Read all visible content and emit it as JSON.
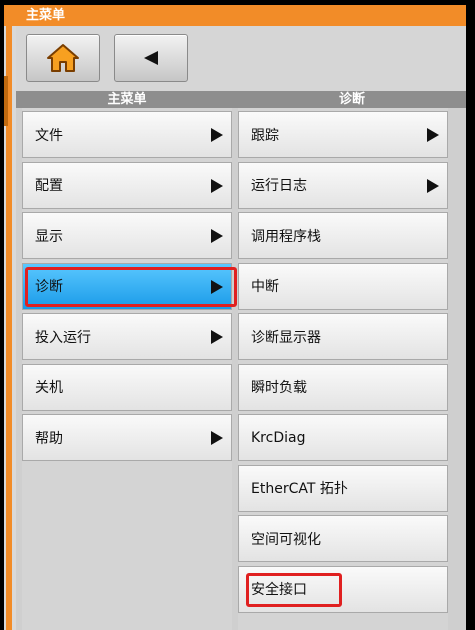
{
  "window": {
    "title": "主菜单"
  },
  "toolbar": {
    "home_icon": "home-icon",
    "back_icon": "back-arrow-icon",
    "accent_color": "#f28c28"
  },
  "main_menu": {
    "header": "主菜单",
    "items": [
      {
        "label": "文件",
        "submenu": true
      },
      {
        "label": "配置",
        "submenu": true
      },
      {
        "label": "显示",
        "submenu": true
      },
      {
        "label": "诊断",
        "submenu": true,
        "selected": true,
        "highlighted": true
      },
      {
        "label": "投入运行",
        "submenu": true
      },
      {
        "label": "关机",
        "submenu": false
      },
      {
        "label": "帮助",
        "submenu": true
      }
    ]
  },
  "diag_menu": {
    "header": "诊断",
    "items": [
      {
        "label": "跟踪",
        "submenu": true
      },
      {
        "label": "运行日志",
        "submenu": true
      },
      {
        "label": "调用程序栈",
        "submenu": false
      },
      {
        "label": "中断",
        "submenu": false
      },
      {
        "label": "诊断显示器",
        "submenu": false
      },
      {
        "label": "瞬时负载",
        "submenu": false
      },
      {
        "label": "KrcDiag",
        "submenu": false
      },
      {
        "label": "EtherCAT 拓扑",
        "submenu": false
      },
      {
        "label": "空间可视化",
        "submenu": false
      },
      {
        "label": "安全接口",
        "submenu": false,
        "highlighted": true
      }
    ]
  },
  "colors": {
    "selected": "#1a9be8",
    "highlight_box": "#e02020",
    "title_bar": "#f28c28"
  }
}
